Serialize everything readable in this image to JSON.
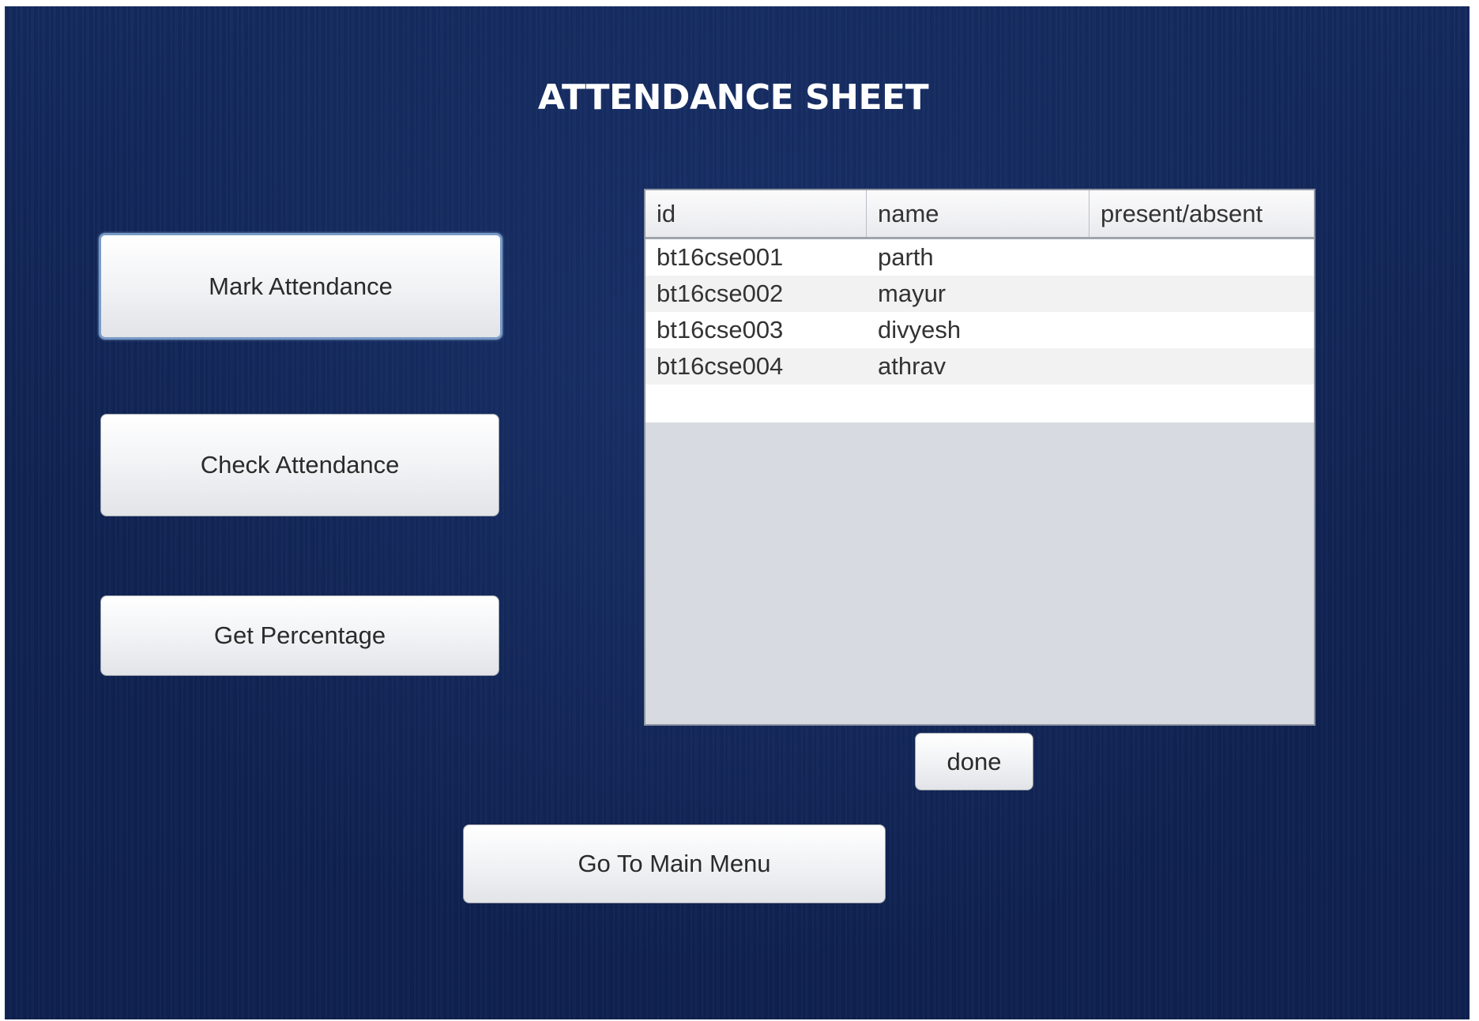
{
  "window": {
    "title": "ATTENDANCE SHEET"
  },
  "menu": {
    "mark_attendance_label": "Mark Attendance",
    "check_attendance_label": "Check Attendance",
    "get_percentage_label": "Get Percentage",
    "go_to_main_menu_label": "Go To Main Menu"
  },
  "table": {
    "columns": [
      "id",
      "name",
      "present/absent"
    ],
    "rows": [
      {
        "id": "bt16cse001",
        "name": "parth",
        "status": ""
      },
      {
        "id": "bt16cse002",
        "name": "mayur",
        "status": ""
      },
      {
        "id": "bt16cse003",
        "name": "divyesh",
        "status": ""
      },
      {
        "id": "bt16cse004",
        "name": "athrav",
        "status": ""
      }
    ],
    "done_label": "done"
  },
  "colors": {
    "background": "#14285a",
    "title_text": "#ffffff",
    "button_face": "#f3f4f6",
    "focused_button_border": "#7a9ac6",
    "table_empty_area": "#d7dae0"
  }
}
